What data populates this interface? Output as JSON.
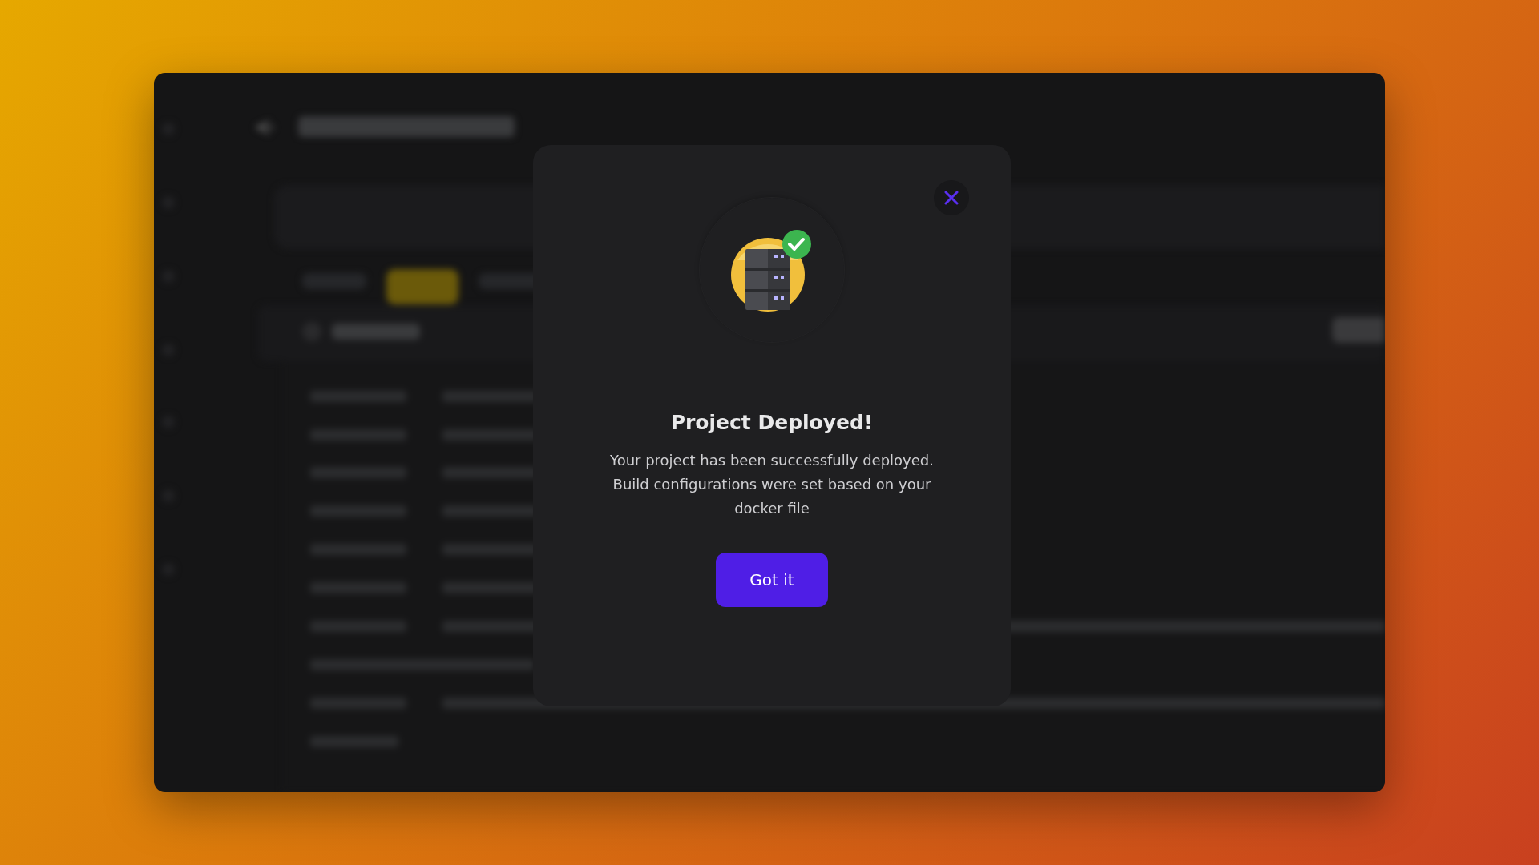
{
  "dialog": {
    "title": "Project Deployed!",
    "message": "Your project has been successfully deployed. Build configurations were set based on your docker file",
    "button": "Got it"
  }
}
